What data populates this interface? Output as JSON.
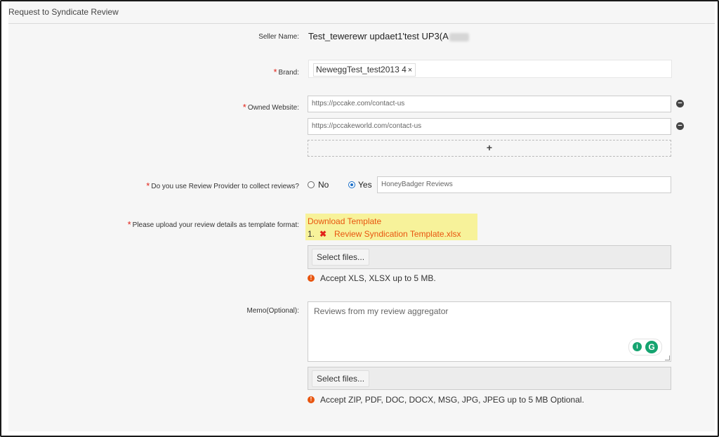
{
  "panel": {
    "title": "Request to Syndicate Review"
  },
  "seller": {
    "label": "Seller Name:",
    "value": "Test_tewerewr updaet1'test UP3(A"
  },
  "brand": {
    "label": "Brand:",
    "tag": "NeweggTest_test2013 4",
    "remove_glyph": "×"
  },
  "website": {
    "label": "Owned Website:",
    "urls": [
      "https://pccake.com/contact-us",
      "https://pccakeworld.com/contact-us"
    ],
    "add_glyph": "+",
    "remove_glyph": "−"
  },
  "provider": {
    "label": "Do you use Review Provider to collect reviews?",
    "option_no": "No",
    "option_yes": "Yes",
    "selected": "Yes",
    "value": "HoneyBadger Reviews"
  },
  "upload": {
    "label": "Please upload your review details as template format:",
    "download_link": "Download Template",
    "file_index": "1.",
    "file_name": "Review Syndication Template.xlsx",
    "select_label": "Select files...",
    "note": "Accept XLS, XLSX up to 5 MB."
  },
  "memo": {
    "label": "Memo(Optional):",
    "value": "Reviews from my review aggregator",
    "select_label": "Select files...",
    "note": "Accept ZIP, PDF, DOC, DOCX, MSG, JPG, JPEG up to 5 MB Optional."
  },
  "required_mark": "*",
  "info_glyph": "!",
  "colors": {
    "required": "#e2231a",
    "link": "#e8550f",
    "highlight": "#f7f29a",
    "radio": "#1a6fc8"
  }
}
